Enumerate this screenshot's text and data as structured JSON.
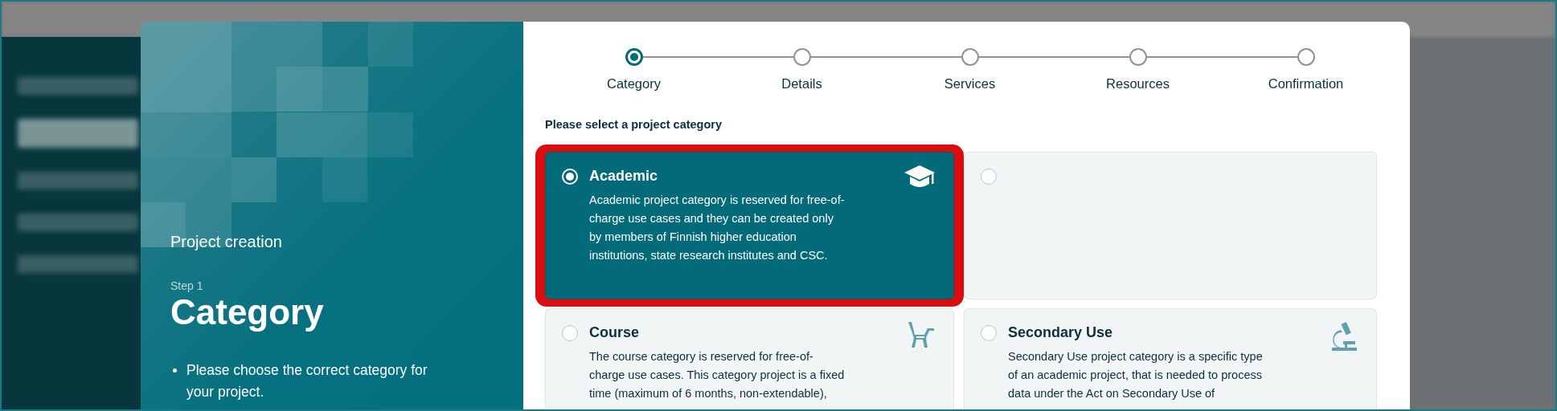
{
  "side_panel": {
    "title": "Project creation",
    "step_label": "Step 1",
    "step_name": "Category",
    "notes": [
      "Please choose the correct category for your project."
    ]
  },
  "stepper": [
    {
      "label": "Category",
      "selected": true
    },
    {
      "label": "Details",
      "selected": false
    },
    {
      "label": "Services",
      "selected": false
    },
    {
      "label": "Resources",
      "selected": false
    },
    {
      "label": "Confirmation",
      "selected": false
    }
  ],
  "prompt": "Please select a project category",
  "categories": [
    {
      "title": "Academic",
      "description": "Academic project category is reserved for free-of-charge use cases and they can be created only by members of Finnish higher education institutions, state research institutes and CSC.",
      "selected": true,
      "highlighted": true
    },
    {
      "selected": false,
      "highlighted": false
    },
    {
      "title": "Course",
      "description": "The course category is reserved for free-of-charge use cases. This category project is a fixed time (maximum of 6 months, non-extendable),",
      "selected": false,
      "highlighted": false
    },
    {
      "title": "Secondary Use",
      "description": "Secondary Use project category is a specific type of an academic project, that is needed to process data under the Act on Secondary Use of",
      "selected": false,
      "highlighted": false
    }
  ]
}
